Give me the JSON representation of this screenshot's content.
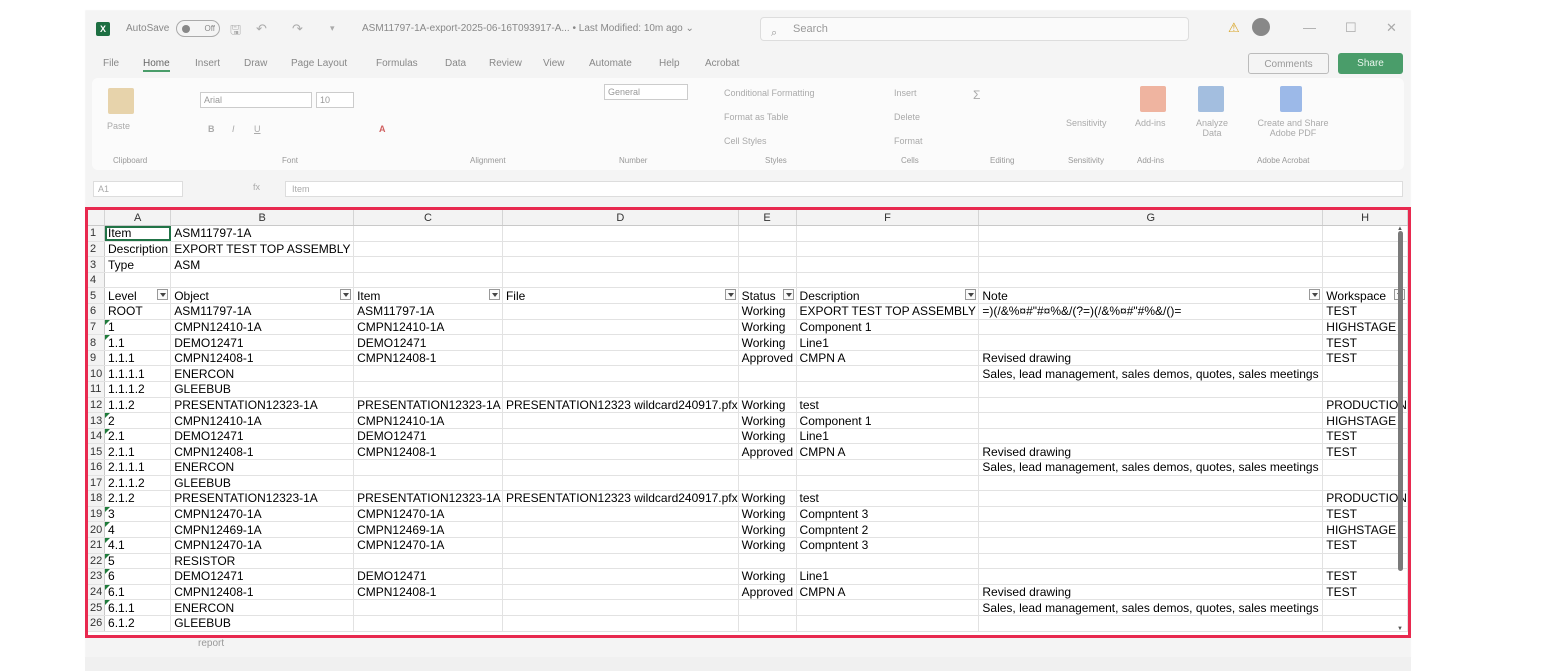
{
  "app": {
    "autosave_label": "AutoSave",
    "autosave_state": "Off",
    "title": "ASM11797-1A-export-2025-06-16T093917-A...",
    "modified": "• Last Modified: 10m ago ⌄",
    "search_placeholder": "Search"
  },
  "menu": {
    "items": [
      "File",
      "Home",
      "Insert",
      "Draw",
      "Page Layout",
      "Formulas",
      "Data",
      "Review",
      "View",
      "Automate",
      "Help",
      "Acrobat"
    ],
    "comments": "Comments",
    "share": "Share"
  },
  "ribbon": {
    "paste": "Paste",
    "font_name": "Arial",
    "font_size": "10",
    "number_format": "General",
    "conditional": "Conditional Formatting",
    "format_table": "Format as Table",
    "cell_styles": "Cell Styles",
    "insert": "Insert",
    "delete": "Delete",
    "format": "Format",
    "sensitivity": "Sensitivity",
    "addins": "Add-ins",
    "analyze": "Analyze Data",
    "acrobat_create": "Create and Share Adobe PDF",
    "groups": [
      "Clipboard",
      "Font",
      "Alignment",
      "Number",
      "Styles",
      "Cells",
      "Editing",
      "Sensitivity",
      "Add-ins",
      "Adobe Acrobat"
    ]
  },
  "formula": {
    "name_box": "A1",
    "content": "Item"
  },
  "grid": {
    "columns": [
      "A",
      "B",
      "C",
      "D",
      "E",
      "F",
      "G",
      "H"
    ],
    "rows": [
      [
        "1",
        "Item",
        "ASM11797-1A",
        "",
        "",
        "",
        "",
        "",
        ""
      ],
      [
        "2",
        "Description",
        "EXPORT TEST TOP ASSEMBLY",
        "",
        "",
        "",
        "",
        "",
        ""
      ],
      [
        "3",
        "Type",
        "ASM",
        "",
        "",
        "",
        "",
        "",
        ""
      ],
      [
        "4",
        "",
        "",
        "",
        "",
        "",
        "",
        "",
        ""
      ],
      [
        "5",
        "Level",
        "Object",
        "Item",
        "File",
        "Status",
        "Description",
        "Note",
        "Workspace"
      ],
      [
        "6",
        "ROOT",
        "ASM11797-1A",
        "ASM11797-1A",
        "",
        "Working",
        "EXPORT TEST TOP ASSEMBLY",
        "=)(/&%¤#\"#¤%&/(?=)(/&%¤#\"#%&/()=",
        "TEST"
      ],
      [
        "7",
        "1",
        "CMPN12410-1A",
        "CMPN12410-1A",
        "",
        "Working",
        "Component 1",
        "",
        "HIGHSTAGE"
      ],
      [
        "8",
        "1.1",
        "DEMO12471",
        "DEMO12471",
        "",
        "Working",
        "Line1",
        "",
        "TEST"
      ],
      [
        "9",
        "1.1.1",
        "CMPN12408-1",
        "CMPN12408-1",
        "",
        "Approved",
        "CMPN A",
        "Revised drawing",
        "TEST"
      ],
      [
        "10",
        "1.1.1.1",
        "ENERCON",
        "",
        "",
        "",
        "",
        "Sales, lead management, sales demos, quotes, sales meetings",
        ""
      ],
      [
        "11",
        "1.1.1.2",
        "GLEEBUB",
        "",
        "",
        "",
        "",
        "",
        ""
      ],
      [
        "12",
        "1.1.2",
        "PRESENTATION12323-1A",
        "PRESENTATION12323-1A",
        "PRESENTATION12323 wildcard240917.pfx",
        "Working",
        "test",
        "",
        "PRODUCTION"
      ],
      [
        "13",
        "2",
        "CMPN12410-1A",
        "CMPN12410-1A",
        "",
        "Working",
        "Component 1",
        "",
        "HIGHSTAGE"
      ],
      [
        "14",
        "2.1",
        "DEMO12471",
        "DEMO12471",
        "",
        "Working",
        "Line1",
        "",
        "TEST"
      ],
      [
        "15",
        "2.1.1",
        "CMPN12408-1",
        "CMPN12408-1",
        "",
        "Approved",
        "CMPN A",
        "Revised drawing",
        "TEST"
      ],
      [
        "16",
        "2.1.1.1",
        "ENERCON",
        "",
        "",
        "",
        "",
        "Sales, lead management, sales demos, quotes, sales meetings",
        ""
      ],
      [
        "17",
        "2.1.1.2",
        "GLEEBUB",
        "",
        "",
        "",
        "",
        "",
        ""
      ],
      [
        "18",
        "2.1.2",
        "PRESENTATION12323-1A",
        "PRESENTATION12323-1A",
        "PRESENTATION12323 wildcard240917.pfx",
        "Working",
        "test",
        "",
        "PRODUCTION"
      ],
      [
        "19",
        "3",
        "CMPN12470-1A",
        "CMPN12470-1A",
        "",
        "Working",
        "Compntent 3",
        "",
        "TEST"
      ],
      [
        "20",
        "4",
        "CMPN12469-1A",
        "CMPN12469-1A",
        "",
        "Working",
        "Compntent 2",
        "",
        "HIGHSTAGE"
      ],
      [
        "21",
        "4.1",
        "CMPN12470-1A",
        "CMPN12470-1A",
        "",
        "Working",
        "Compntent 3",
        "",
        "TEST"
      ],
      [
        "22",
        "5",
        "RESISTOR",
        "",
        "",
        "",
        "",
        "",
        ""
      ],
      [
        "23",
        "6",
        "DEMO12471",
        "DEMO12471",
        "",
        "Working",
        "Line1",
        "",
        "TEST"
      ],
      [
        "24",
        "6.1",
        "CMPN12408-1",
        "CMPN12408-1",
        "",
        "Approved",
        "CMPN A",
        "Revised drawing",
        "TEST"
      ],
      [
        "25",
        "6.1.1",
        "ENERCON",
        "",
        "",
        "",
        "",
        "Sales, lead management, sales demos, quotes, sales meetings",
        ""
      ],
      [
        "26",
        "6.1.2",
        "GLEEBUB",
        "",
        "",
        "",
        "",
        "",
        ""
      ]
    ]
  },
  "sheet": {
    "active_tab": "report"
  },
  "colors": {
    "highlight_border": "#e8294f",
    "excel_green": "#217346"
  }
}
